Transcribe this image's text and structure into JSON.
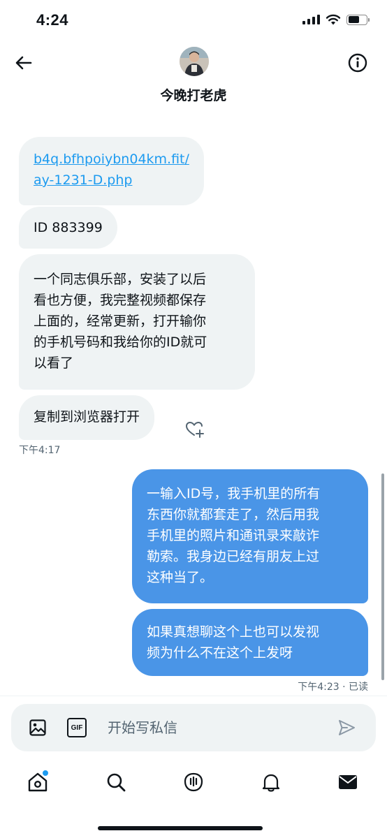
{
  "status_bar": {
    "time": "4:24"
  },
  "header": {
    "contact_name": "今晚打老虎"
  },
  "messages": {
    "received": [
      {
        "lines": [
          "b4q.bfhpoiybn04km.fit/",
          "ay-1231-D.php"
        ]
      },
      {
        "lines": [
          "ID 883399"
        ]
      },
      {
        "lines": [
          "一个同志俱乐部，安装了以后",
          "看也方便，我完整视频都保存",
          "上面的，经常更新，打开输你",
          "的手机号码和我给你的ID就可",
          "以看了"
        ]
      },
      {
        "lines": [
          "复制到浏览器打开"
        ]
      }
    ],
    "received_time": "下午4:17",
    "sent": [
      {
        "lines": [
          "一输入ID号，我手机里的所有",
          "东西你就都套走了，然后用我",
          "手机里的照片和通讯录来敲诈",
          "勒索。我身边已经有朋友上过",
          "这种当了。"
        ]
      },
      {
        "lines": [
          "如果真想聊这个上也可以发视",
          "频为什么不在这个上发呀"
        ]
      }
    ],
    "sent_status": "下午4:23 · 已读"
  },
  "composer": {
    "placeholder": "开始写私信",
    "gif_label": "GIF"
  },
  "colors": {
    "accent": "#1d9bf0",
    "sent_bubble": "#4a95e7",
    "received_bubble": "#eff3f4",
    "text_primary": "#0f1419",
    "text_secondary": "#536471"
  },
  "icons": {
    "header": [
      "back-arrow-icon",
      "info-icon"
    ],
    "composer": [
      "image-icon",
      "gif-icon",
      "send-icon"
    ],
    "tabs": [
      "home-icon",
      "search-icon",
      "spaces-icon",
      "notifications-icon",
      "messages-icon"
    ]
  }
}
